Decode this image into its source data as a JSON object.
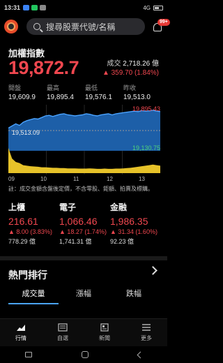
{
  "status": {
    "time": "13:31",
    "battery_label": "",
    "network": "4G"
  },
  "search": {
    "placeholder": "搜尋股票代號/名稱",
    "badge": "99+"
  },
  "index": {
    "name": "加權指數",
    "value": "19,872.7",
    "volume_label": "成交",
    "volume": "2,718.26 億",
    "change": "▲ 359.70 (1.84%)"
  },
  "ohlc": [
    {
      "label": "開盤",
      "value": "19,609.9"
    },
    {
      "label": "最高",
      "value": "19,895.4"
    },
    {
      "label": "最低",
      "value": "19,576.1"
    },
    {
      "label": "昨收",
      "value": "19,513.0"
    }
  ],
  "chart_data": {
    "type": "area",
    "x_ticks": [
      "09",
      "10",
      "11",
      "12",
      "13"
    ],
    "high_label": "19,895.43",
    "prev_close_label": "19,513.09",
    "low_label": "19,130.75",
    "ylim": [
      19130.75,
      19895.43
    ],
    "prev_close": 19513.09,
    "series": [
      {
        "values": [
          19560,
          19600,
          19640,
          19610,
          19670,
          19700,
          19720,
          19740,
          19730,
          19760,
          19790,
          19800,
          19780,
          19800,
          19820,
          19830,
          19810,
          19800,
          19790,
          19800,
          19810,
          19830,
          19820,
          19800,
          19790,
          19810,
          19820,
          19830,
          19810,
          19830,
          19840,
          19850,
          19860,
          19870,
          19880,
          19870,
          19890,
          19880,
          19885,
          19895,
          19880,
          19872
        ]
      },
      {
        "values": [
          0.95,
          0.55,
          0.42,
          0.38,
          0.3,
          0.28,
          0.26,
          0.25,
          0.24,
          0.22,
          0.22,
          0.21,
          0.2,
          0.2,
          0.19,
          0.19,
          0.18,
          0.18,
          0.18,
          0.17,
          0.17,
          0.17,
          0.18,
          0.17,
          0.16,
          0.16,
          0.17,
          0.16,
          0.16,
          0.17,
          0.17,
          0.18,
          0.19,
          0.2,
          0.22,
          0.24,
          0.26,
          0.28,
          0.3,
          0.32,
          0.3,
          0.28
        ]
      }
    ]
  },
  "note": "註：成交金額含盤後定價，不含零股、鉅額、拍賣及標購。",
  "sectors": [
    {
      "name": "上櫃",
      "price": "216.61",
      "change": "▲ 8.00 (3.83%)",
      "amount": "778.29 億"
    },
    {
      "name": "電子",
      "price": "1,066.46",
      "change": "▲ 18.27 (1.74%)",
      "amount": "1,741.31 億"
    },
    {
      "name": "金融",
      "price": "1,986.35",
      "change": "▲ 31.34 (1.60%)",
      "amount": "92.23 億"
    }
  ],
  "hot": {
    "title": "熱門排行",
    "tabs": [
      "成交量",
      "漲幅",
      "跌幅"
    ]
  },
  "nav": [
    {
      "label": "行情"
    },
    {
      "label": "自選"
    },
    {
      "label": "新聞"
    },
    {
      "label": "更多"
    }
  ],
  "colors": {
    "up": "#f0474f",
    "accent": "#4aa3ff",
    "volume": "#e6c229",
    "low": "#4fd37a"
  }
}
